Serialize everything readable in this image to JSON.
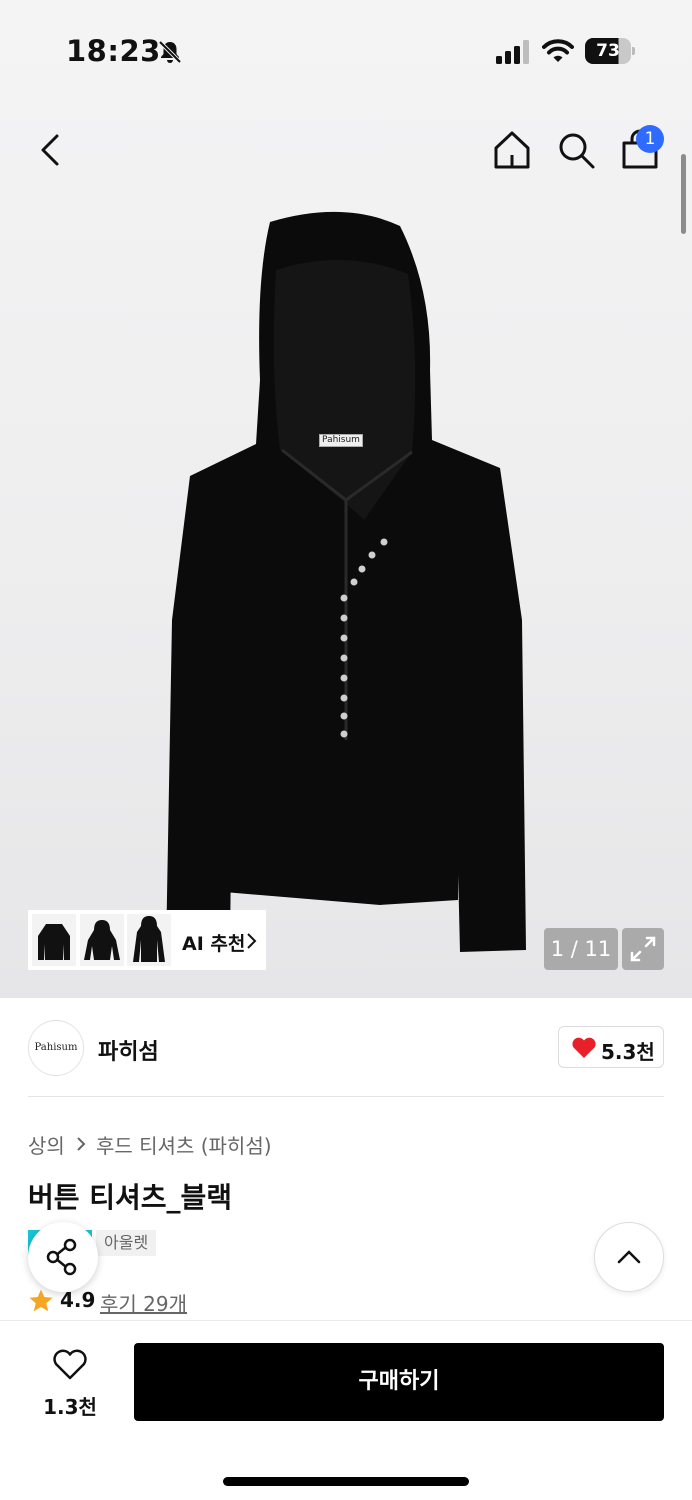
{
  "status_bar": {
    "time": "18:23",
    "battery": "73"
  },
  "header": {
    "cart_count": "1"
  },
  "gallery": {
    "image_label": "Pahisum",
    "ai_label": "AI 추천",
    "counter": "1 / 11"
  },
  "brand": {
    "logo_text": "Pahisum",
    "name": "파히섬",
    "likes": "5.3천"
  },
  "product": {
    "category": "상의",
    "subcategory": "후드 티셔츠 (파히섬)",
    "title": "버튼 티셔츠_블랙",
    "tag": "아울렛",
    "rating": "4.9",
    "reviews": "후기 29개"
  },
  "bottom_bar": {
    "wish_count": "1.3천",
    "buy_label": "구매하기"
  },
  "colors": {
    "accent_blue": "#2f6bff",
    "heart_red": "#e8202a",
    "star_orange": "#f5a623",
    "tag_cyan": "#19c3d3"
  }
}
